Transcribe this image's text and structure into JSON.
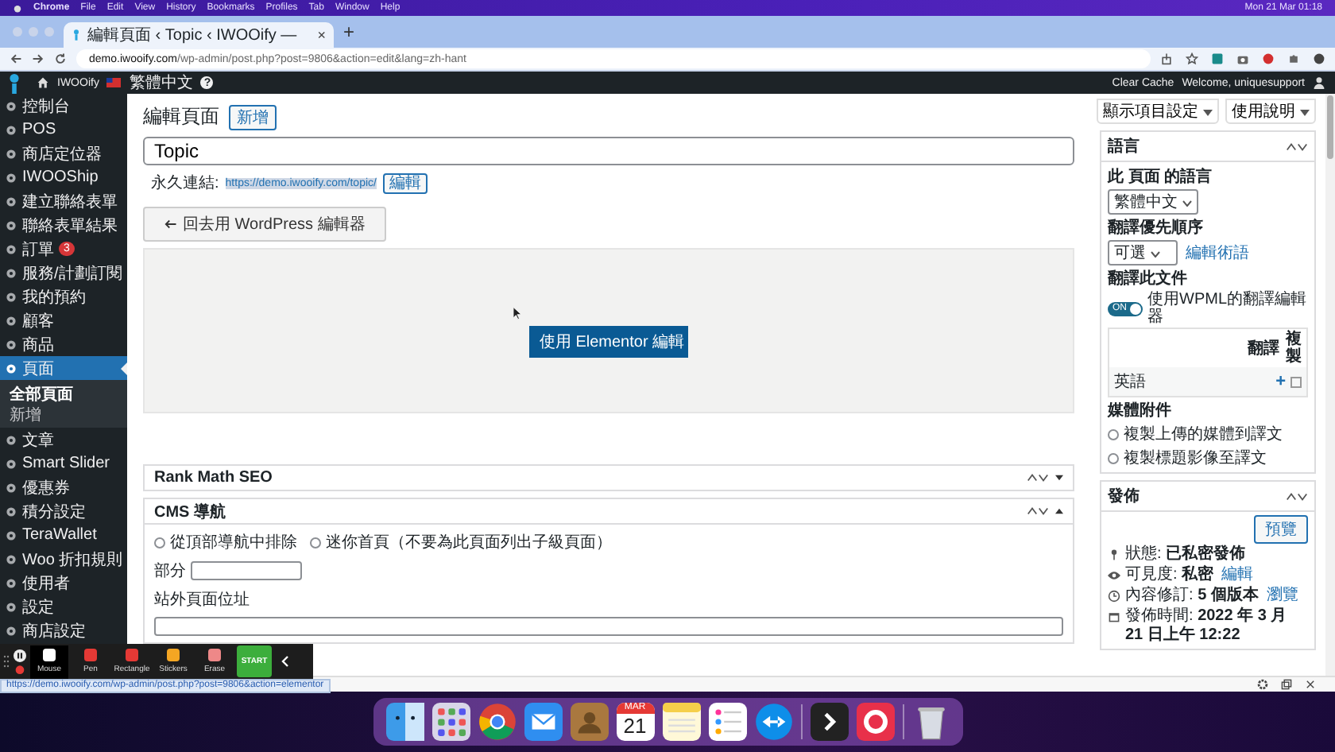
{
  "menubar": {
    "app": "Chrome",
    "menus": [
      "File",
      "Edit",
      "View",
      "History",
      "Bookmarks",
      "Profiles",
      "Tab",
      "Window",
      "Help"
    ],
    "clock": "Mon 21 Mar 01:18"
  },
  "browser": {
    "tab_title": "編輯頁面 ‹ Topic ‹ IWOOify —",
    "tab_close": "×",
    "new_tab": "+",
    "url_host": "demo.iwooify.com",
    "url_path": "/wp-admin/post.php?post=9806&action=edit&lang=zh-hant"
  },
  "admin_bar": {
    "site": "IWOOify",
    "language": "繁體中文",
    "help": "?",
    "clear_cache": "Clear Cache",
    "welcome": "Welcome, uniquesupport"
  },
  "sidebar": {
    "items": [
      {
        "label": "控制台",
        "selected": false
      },
      {
        "label": "POS",
        "selected": false
      },
      {
        "label": "商店定位器",
        "selected": false
      },
      {
        "label": "IWOOShip",
        "selected": false
      },
      {
        "label": "建立聯絡表單",
        "selected": false
      },
      {
        "label": "聯絡表單結果",
        "selected": false
      },
      {
        "label": "訂單",
        "selected": false,
        "badge": "3"
      },
      {
        "label": "服務/計劃訂閱",
        "selected": false
      },
      {
        "label": "我的預約",
        "selected": false
      },
      {
        "label": "顧客",
        "selected": false
      },
      {
        "label": "商品",
        "selected": false
      },
      {
        "label": "頁面",
        "selected": true,
        "children": [
          {
            "label": "全部頁面",
            "selected": true
          },
          {
            "label": "新增",
            "selected": false
          }
        ]
      },
      {
        "label": "文章",
        "selected": false
      },
      {
        "label": "Smart Slider",
        "selected": false
      },
      {
        "label": "優惠券",
        "selected": false
      },
      {
        "label": "積分設定",
        "selected": false
      },
      {
        "label": "TeraWallet",
        "selected": false
      },
      {
        "label": "Woo 折扣規則",
        "selected": false
      },
      {
        "label": "使用者",
        "selected": false
      },
      {
        "label": "設定",
        "selected": false
      },
      {
        "label": "商店設定",
        "selected": false
      }
    ]
  },
  "main": {
    "heading": "編輯頁面",
    "add_new": "新增",
    "title_value": "Topic",
    "permalink_label": "永久連結:",
    "permalink_url": "https://demo.iwooify.com/topic/",
    "permalink_edit": "編輯",
    "back_button": "回去用 WordPress 編輯器",
    "elementor_button": "使用 Elementor 編輯",
    "boxes": [
      {
        "title": "Rank Math SEO",
        "expanded": false
      },
      {
        "title": "CMS 導航",
        "expanded": true
      }
    ],
    "cms": {
      "options": [
        {
          "label": "從頂部導航中排除",
          "selected": false
        },
        {
          "label": "迷你首頁（不要為此頁面列出子級頁面）",
          "selected": false
        }
      ],
      "section_label": "部分",
      "offsite_label": "站外頁面位址"
    }
  },
  "screen_options": [
    "顯示項目設定",
    "使用說明"
  ],
  "language_box": {
    "title": "語言",
    "page_language_label": "此 頁面 的語言",
    "page_language": "繁體中文",
    "priority_label": "翻譯優先順序",
    "priority": "可選",
    "edit_terms": "編輯術語",
    "translate_label": "翻譯此文件",
    "toggle": {
      "label": "ON",
      "on": true
    },
    "toggle_text": "使用WPML的翻譯編輯器",
    "table_headers": [
      "翻譯",
      "複製"
    ],
    "rows": [
      {
        "language": "英語",
        "add": "+",
        "duplicate": false
      }
    ],
    "media_label": "媒體附件",
    "media_options": [
      {
        "label": "複製上傳的媒體到譯文",
        "selected": false
      },
      {
        "label": "複製標題影像至譯文",
        "selected": false
      }
    ]
  },
  "publish_box": {
    "title": "發佈",
    "preview": "預覽",
    "status_label": "狀態:",
    "status": "已私密發佈",
    "visibility_label": "可見度:",
    "visibility": "私密",
    "visibility_edit": "編輯",
    "revisions_label": "內容修訂:",
    "revisions": "5 個版本",
    "revisions_link": "瀏覽",
    "date_label": "發佈時間:",
    "date": "2022 年 3 月 21 日上午 12:22"
  },
  "status_url": "https://demo.iwooify.com/wp-admin/post.php?post=9806&action=elementor",
  "annotate_toolbar": {
    "tools": [
      {
        "label": "Mouse",
        "selected": true
      },
      {
        "label": "Pen",
        "selected": false
      },
      {
        "label": "Rectangle",
        "selected": false
      },
      {
        "label": "Stickers",
        "selected": false
      },
      {
        "label": "Erase",
        "selected": false
      }
    ],
    "start": "START"
  },
  "dock": {
    "calendar_month": "MAR",
    "calendar_day": "21"
  }
}
